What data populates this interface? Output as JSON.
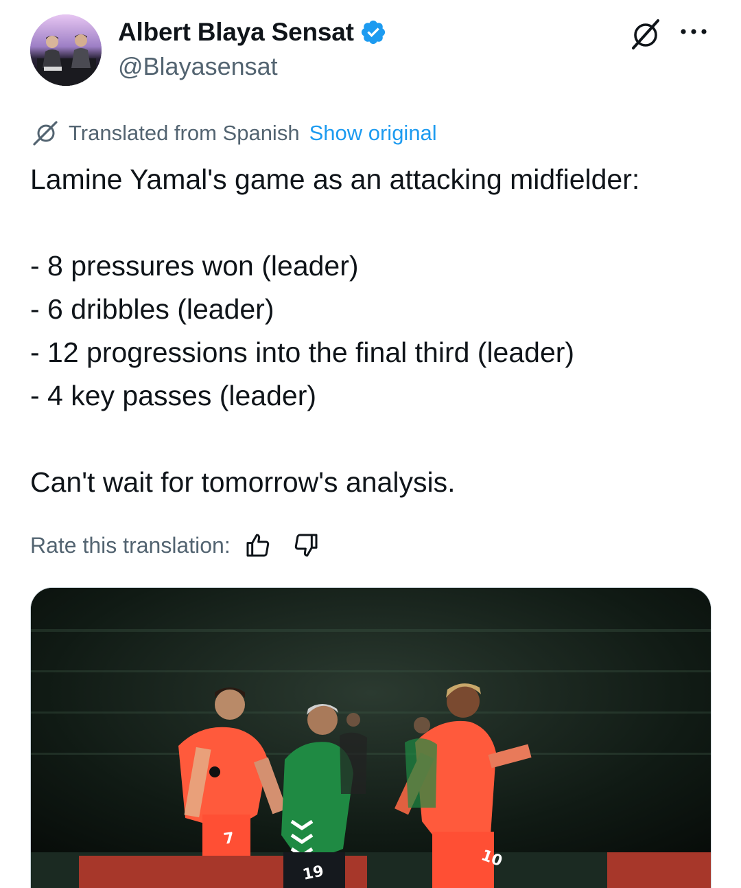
{
  "author": {
    "display_name": "Albert Blaya Sensat",
    "handle": "@Blayasensat",
    "verified": true,
    "verified_color": "#1d9bf0",
    "avatar_icon": "profile-photo-two-people"
  },
  "header": {
    "grok_icon": "grok-icon",
    "more_icon": "more-icon"
  },
  "translation": {
    "label": "Translated from Spanish",
    "show_original": "Show original",
    "rate_label": "Rate this translation:",
    "thumbs_up_icon": "thumbs-up-icon",
    "thumbs_down_icon": "thumbs-down-icon"
  },
  "tweet": {
    "intro": "Lamine Yamal's game as an attacking midfielder:",
    "stats": [
      "- 8 pressures won (leader)",
      "- 6 dribbles (leader)",
      "- 12 progressions into the final third (leader)",
      "- 4 key passes (leader)"
    ],
    "closing": "Can't wait for tomorrow's analysis."
  },
  "media": {
    "description_icon": "football-match-photo",
    "jersey_numbers": [
      "7",
      "19",
      "10"
    ]
  },
  "colors": {
    "accent": "#1d9bf0",
    "secondary_text": "#536471",
    "primary_text": "#0f1419"
  }
}
